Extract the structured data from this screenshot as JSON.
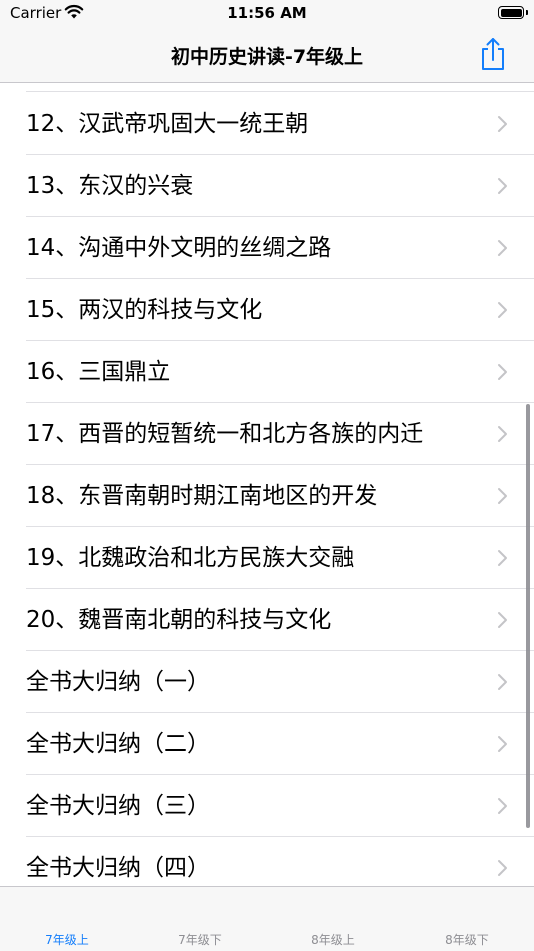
{
  "status": {
    "carrier": "Carrier",
    "time": "11:56 AM"
  },
  "nav": {
    "title": "初中历史讲读-7年级上"
  },
  "list": [
    "12、汉武帝巩固大一统王朝",
    "13、东汉的兴衰",
    "14、沟通中外文明的丝绸之路",
    "15、两汉的科技与文化",
    "16、三国鼎立",
    "17、西晋的短暂统一和北方各族的内迁",
    "18、东晋南朝时期江南地区的开发",
    "19、北魏政治和北方民族大交融",
    "20、魏晋南北朝的科技与文化",
    "全书大归纳（一）",
    "全书大归纳（二）",
    "全书大归纳（三）",
    "全书大归纳（四）"
  ],
  "tabs": [
    {
      "label": "7年级上",
      "active": true
    },
    {
      "label": "7年级下",
      "active": false
    },
    {
      "label": "8年级上",
      "active": false
    },
    {
      "label": "8年级下",
      "active": false
    }
  ],
  "colors": {
    "accent": "#147efb",
    "inactive": "#8e8e93",
    "bar_bg": "#f7f7f7"
  }
}
